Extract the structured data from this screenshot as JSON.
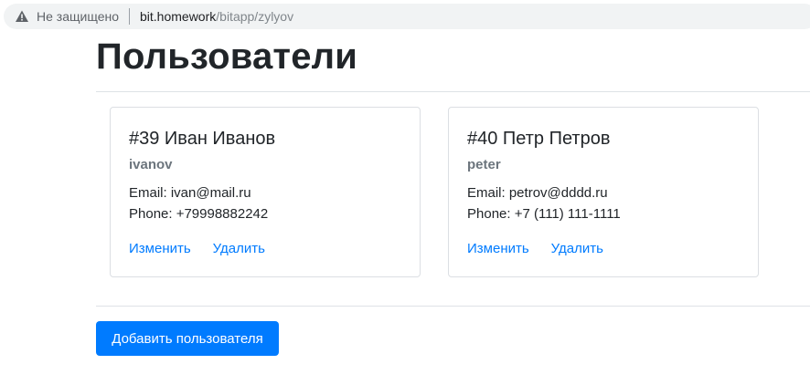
{
  "browser": {
    "security_label": "Не защищено",
    "url_host": "bit.homework",
    "url_path": "/bitapp/zylyov"
  },
  "page": {
    "title": "Пользователи",
    "add_button_label": "Добавить пользователя"
  },
  "users": [
    {
      "title": "#39 Иван Иванов",
      "login": "ivanov",
      "email_line": "Email: ivan@mail.ru",
      "phone_line": "Phone: +79998882242",
      "edit_label": "Изменить",
      "delete_label": "Удалить"
    },
    {
      "title": "#40 Петр Петров",
      "login": "peter",
      "email_line": "Email: petrov@dddd.ru",
      "phone_line": "Phone: +7 (111) 111-1111",
      "edit_label": "Изменить",
      "delete_label": "Удалить"
    }
  ],
  "colors": {
    "link": "#007bff",
    "button": "#007bff",
    "muted": "#6c757d"
  }
}
